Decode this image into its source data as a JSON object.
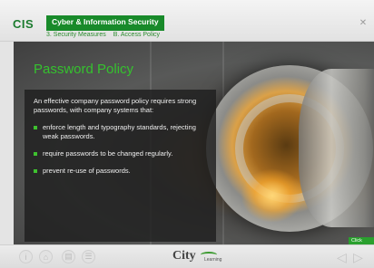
{
  "header": {
    "logo": "CIS",
    "course_title": "Cyber & Information Security",
    "breadcrumb": {
      "module": "3. Security Measures",
      "section": "B. Access Policy"
    },
    "close_icon": "close-icon"
  },
  "slide": {
    "title": "Password Policy",
    "intro": "An effective company password policy requires strong passwords, with company systems that:",
    "bullets": [
      "enforce length and typography standards, rejecting weak passwords.",
      "require passwords to be changed regularly.",
      "prevent re-use of passwords."
    ],
    "accent_color": "#3ec12f"
  },
  "footer": {
    "icons": [
      "info-icon",
      "home-icon",
      "glossary-icon",
      "menu-icon"
    ],
    "brand": "City",
    "brand_sub": "Learning",
    "click_next": "Click Next",
    "prev_icon": "prev-arrow-icon",
    "next_icon": "next-arrow-icon"
  }
}
